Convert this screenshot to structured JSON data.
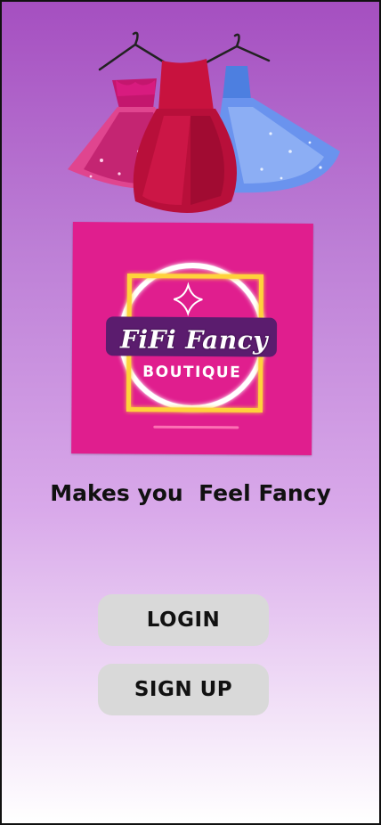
{
  "logo": {
    "title": "FiFi Fancy",
    "subtitle": "BOUTIQUE"
  },
  "tagline": "Makes you  Feel Fancy",
  "buttons": {
    "login": "LOGIN",
    "signup": "SIGN UP"
  },
  "colors": {
    "background_top": "#a54fc0",
    "background_bottom": "#ffffff",
    "logo_card": "#e01e8e",
    "button": "#d9d9d9",
    "neon_frame": "#ffd23a"
  }
}
